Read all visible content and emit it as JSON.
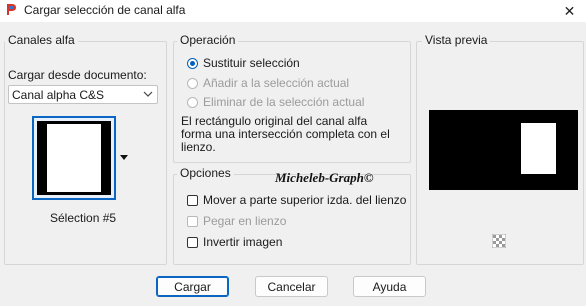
{
  "window": {
    "title": "Cargar selección de canal alfa",
    "close_glyph": "✕"
  },
  "channels": {
    "group_label": "Canales alfa",
    "source_label": "Cargar desde documento:",
    "source_value": "Canal alpha C&S",
    "selected_thumbnail_label": "Sélection #5"
  },
  "operation": {
    "group_label": "Operación",
    "options": [
      {
        "label": "Sustituir selección",
        "checked": true,
        "enabled": true
      },
      {
        "label": "Añadir a la selección actual",
        "checked": false,
        "enabled": false
      },
      {
        "label": "Eliminar de la selección actual",
        "checked": false,
        "enabled": false
      }
    ],
    "description": "El rectángulo original del canal alfa forma una intersección completa con el lienzo."
  },
  "options": {
    "group_label": "Opciones",
    "items": [
      {
        "label": "Mover a parte superior izda. del lienzo",
        "checked": false,
        "enabled": true
      },
      {
        "label": "Pegar en lienzo",
        "checked": false,
        "enabled": false
      },
      {
        "label": "Invertir imagen",
        "checked": false,
        "enabled": true
      }
    ]
  },
  "preview": {
    "group_label": "Vista previa"
  },
  "buttons": {
    "load": "Cargar",
    "cancel": "Cancelar",
    "help": "Ayuda"
  },
  "watermark": "Micheleb-Graph©",
  "colors": {
    "accent": "#005fb8",
    "window_bg": "#f0f0f0",
    "preview_bg": "#000000",
    "preview_selection": "#ffffff"
  },
  "icons": {
    "app": "paint-shop-pro-icon",
    "dropdown": "chevron-down-icon",
    "thumbnail_menu": "triangle-down-icon",
    "transparency": "checkerboard-icon"
  }
}
